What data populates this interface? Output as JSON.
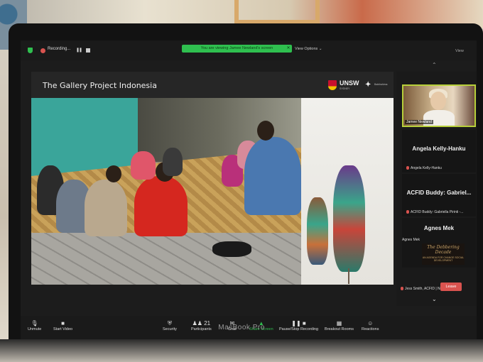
{
  "zoom": {
    "recording_label": "Recording...",
    "viewing_banner": "You are viewing Jamee Newland's screen",
    "view_options": "View Options ⌄",
    "view_right": "View"
  },
  "shared": {
    "title": "The Gallery Project Indonesia",
    "unsw_label": "UNSW",
    "unsw_sub": "SYDNEY",
    "partner_label": "Baktirahima"
  },
  "participants_panel": {
    "tiles": [
      {
        "name": "Jamee Newland"
      },
      {
        "big_name": "Angela Kelly-Hanku",
        "small_name": "Angela Kelly-Hanku"
      },
      {
        "big_name": "ACFID Buddy: Gabriel...",
        "small_name": "ACFID Buddy: Gabriella Pirinti -..."
      },
      {
        "big_name": "Agnes Mek",
        "small_name": "Agnes Mek"
      }
    ],
    "poster_title": "The Debbering Decade",
    "poster_sub": "AN AGENDA FOR CHANGE SOCIAL DEVELOPMENT",
    "jess_label": "Jess Smith, ACFID | Ngunnawal C..."
  },
  "toolbar": {
    "unmute": "Unmute",
    "start_video": "Start Video",
    "security": "Security",
    "participants": "Participants",
    "participants_count": "21",
    "chat": "Chat",
    "share_screen": "Share Screen",
    "pause_recording": "Pause/Stop Recording",
    "breakout": "Breakout Rooms",
    "reactions": "Reactions",
    "leave": "Leave"
  },
  "laptop": {
    "brand": "MacBook Pro"
  },
  "colors": {
    "zoom_green": "#2fbf4f",
    "leave_red": "#d9534f",
    "active_speaker": "#b7cf3a"
  }
}
